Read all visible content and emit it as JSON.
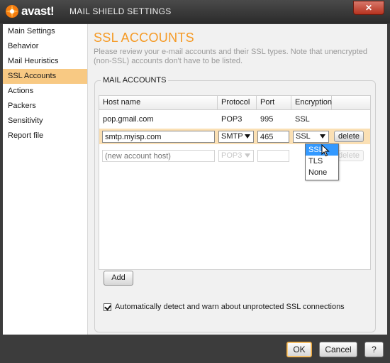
{
  "window": {
    "logo_text": "avast!",
    "title": "MAIL SHIELD SETTINGS",
    "close_label": "✕"
  },
  "sidebar": {
    "items": [
      {
        "label": "Main Settings"
      },
      {
        "label": "Behavior"
      },
      {
        "label": "Mail Heuristics"
      },
      {
        "label": "SSL Accounts"
      },
      {
        "label": "Actions"
      },
      {
        "label": "Packers"
      },
      {
        "label": "Sensitivity"
      },
      {
        "label": "Report file"
      }
    ],
    "selected": "SSL Accounts"
  },
  "main": {
    "title": "SSL ACCOUNTS",
    "description": "Please review your e-mail accounts and their SSL types. Note that unencrypted (non-SSL) accounts don't have to be listed.",
    "group_label": "MAIL ACCOUNTS",
    "table": {
      "headers": [
        "Host name",
        "Protocol",
        "Port",
        "Encryption"
      ],
      "rows": [
        {
          "host": "pop.gmail.com",
          "protocol": "POP3",
          "port": "995",
          "encryption": "SSL"
        }
      ],
      "edit_row": {
        "host": "smtp.myisp.com",
        "protocol": "SMTP",
        "port": "465",
        "encryption": "SSL",
        "delete_label": "delete"
      },
      "new_row": {
        "host_placeholder": "(new account host)",
        "protocol": "POP3",
        "port": "",
        "delete_label": "delete"
      }
    },
    "encryption_options": [
      "SSL",
      "TLS",
      "None"
    ],
    "encryption_highlighted": "SSL",
    "add_label": "Add",
    "auto_detect_label": "Automatically detect and warn about unprotected SSL connections",
    "auto_detect_checked": true
  },
  "footer": {
    "ok_label": "OK",
    "cancel_label": "Cancel",
    "help_label": "?"
  },
  "colors": {
    "accent": "#f59a25",
    "selected_nav": "#f8c983",
    "edit_row": "#fbe0b4",
    "chrome": "#3c3c3c"
  }
}
